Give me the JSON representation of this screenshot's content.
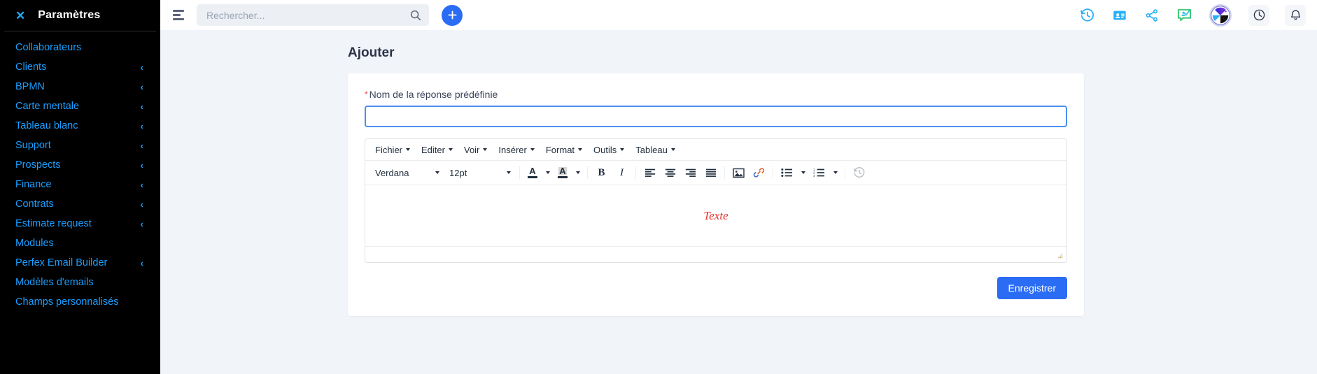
{
  "sidebar": {
    "close_icon": "close-icon",
    "title": "Paramètres",
    "items": [
      {
        "label": "Collaborateurs",
        "expandable": false
      },
      {
        "label": "Clients",
        "expandable": true
      },
      {
        "label": "BPMN",
        "expandable": true
      },
      {
        "label": "Carte mentale",
        "expandable": true
      },
      {
        "label": "Tableau blanc",
        "expandable": true
      },
      {
        "label": "Support",
        "expandable": true
      },
      {
        "label": "Prospects",
        "expandable": true
      },
      {
        "label": "Finance",
        "expandable": true
      },
      {
        "label": "Contrats",
        "expandable": true
      },
      {
        "label": "Estimate request",
        "expandable": true
      },
      {
        "label": "Modules",
        "expandable": false
      },
      {
        "label": "Perfex Email Builder",
        "expandable": true
      },
      {
        "label": "Modèles d'emails",
        "expandable": false
      },
      {
        "label": "Champs personnalisés",
        "expandable": false
      }
    ],
    "caret": "‹",
    "bg_color": "#000000",
    "link_color": "#1a9fff"
  },
  "topbar": {
    "menu_toggle_icon": "hamburger-menu-icon",
    "search": {
      "value": "",
      "placeholder": "Rechercher...",
      "icon": "search-icon"
    },
    "add_button": {
      "icon": "plus-icon",
      "color": "#2b6cf5"
    },
    "icons": [
      {
        "name": "history-icon",
        "color": "#29b0f7"
      },
      {
        "name": "contact-card-icon",
        "color": "#29b0f7"
      },
      {
        "name": "share-icon",
        "color": "#29b0f7"
      },
      {
        "name": "chat-approved-icon",
        "color": "#2fc46b"
      }
    ],
    "avatar": {
      "name": "user-avatar",
      "alt": "pinwheel-avatar"
    },
    "right_icons": [
      {
        "name": "clock-icon",
        "color": "#2c3348"
      },
      {
        "name": "notifications-bell-icon",
        "color": "#2c3348"
      }
    ]
  },
  "main": {
    "page_title": "Ajouter",
    "form": {
      "name_field": {
        "required_marker": "*",
        "label": "Nom de la réponse prédéfinie",
        "value": "",
        "placeholder": ""
      },
      "save_label": "Enregistrer",
      "save_color": "#2b6cf5"
    },
    "editor": {
      "menus": [
        {
          "label": "Fichier"
        },
        {
          "label": "Editer"
        },
        {
          "label": "Voir"
        },
        {
          "label": "Insérer"
        },
        {
          "label": "Format"
        },
        {
          "label": "Outils"
        },
        {
          "label": "Tableau"
        }
      ],
      "font_family": "Verdana",
      "font_size": "12pt",
      "buttons": [
        {
          "name": "text-color-icon",
          "label": "A"
        },
        {
          "name": "highlight-color-icon",
          "label": "A"
        },
        {
          "name": "bold-icon",
          "label": "B"
        },
        {
          "name": "italic-icon",
          "label": "I"
        },
        {
          "name": "align-left-icon",
          "label": ""
        },
        {
          "name": "align-center-icon",
          "label": ""
        },
        {
          "name": "align-right-icon",
          "label": ""
        },
        {
          "name": "align-justify-icon",
          "label": ""
        },
        {
          "name": "insert-image-icon",
          "label": ""
        },
        {
          "name": "insert-link-icon",
          "label": ""
        },
        {
          "name": "bullet-list-icon",
          "label": ""
        },
        {
          "name": "numbered-list-icon",
          "label": ""
        },
        {
          "name": "restore-draft-icon",
          "label": ""
        }
      ],
      "content_text": "Texte",
      "content_color": "#e8302a",
      "resize_handle": "resize-grip-icon"
    }
  }
}
